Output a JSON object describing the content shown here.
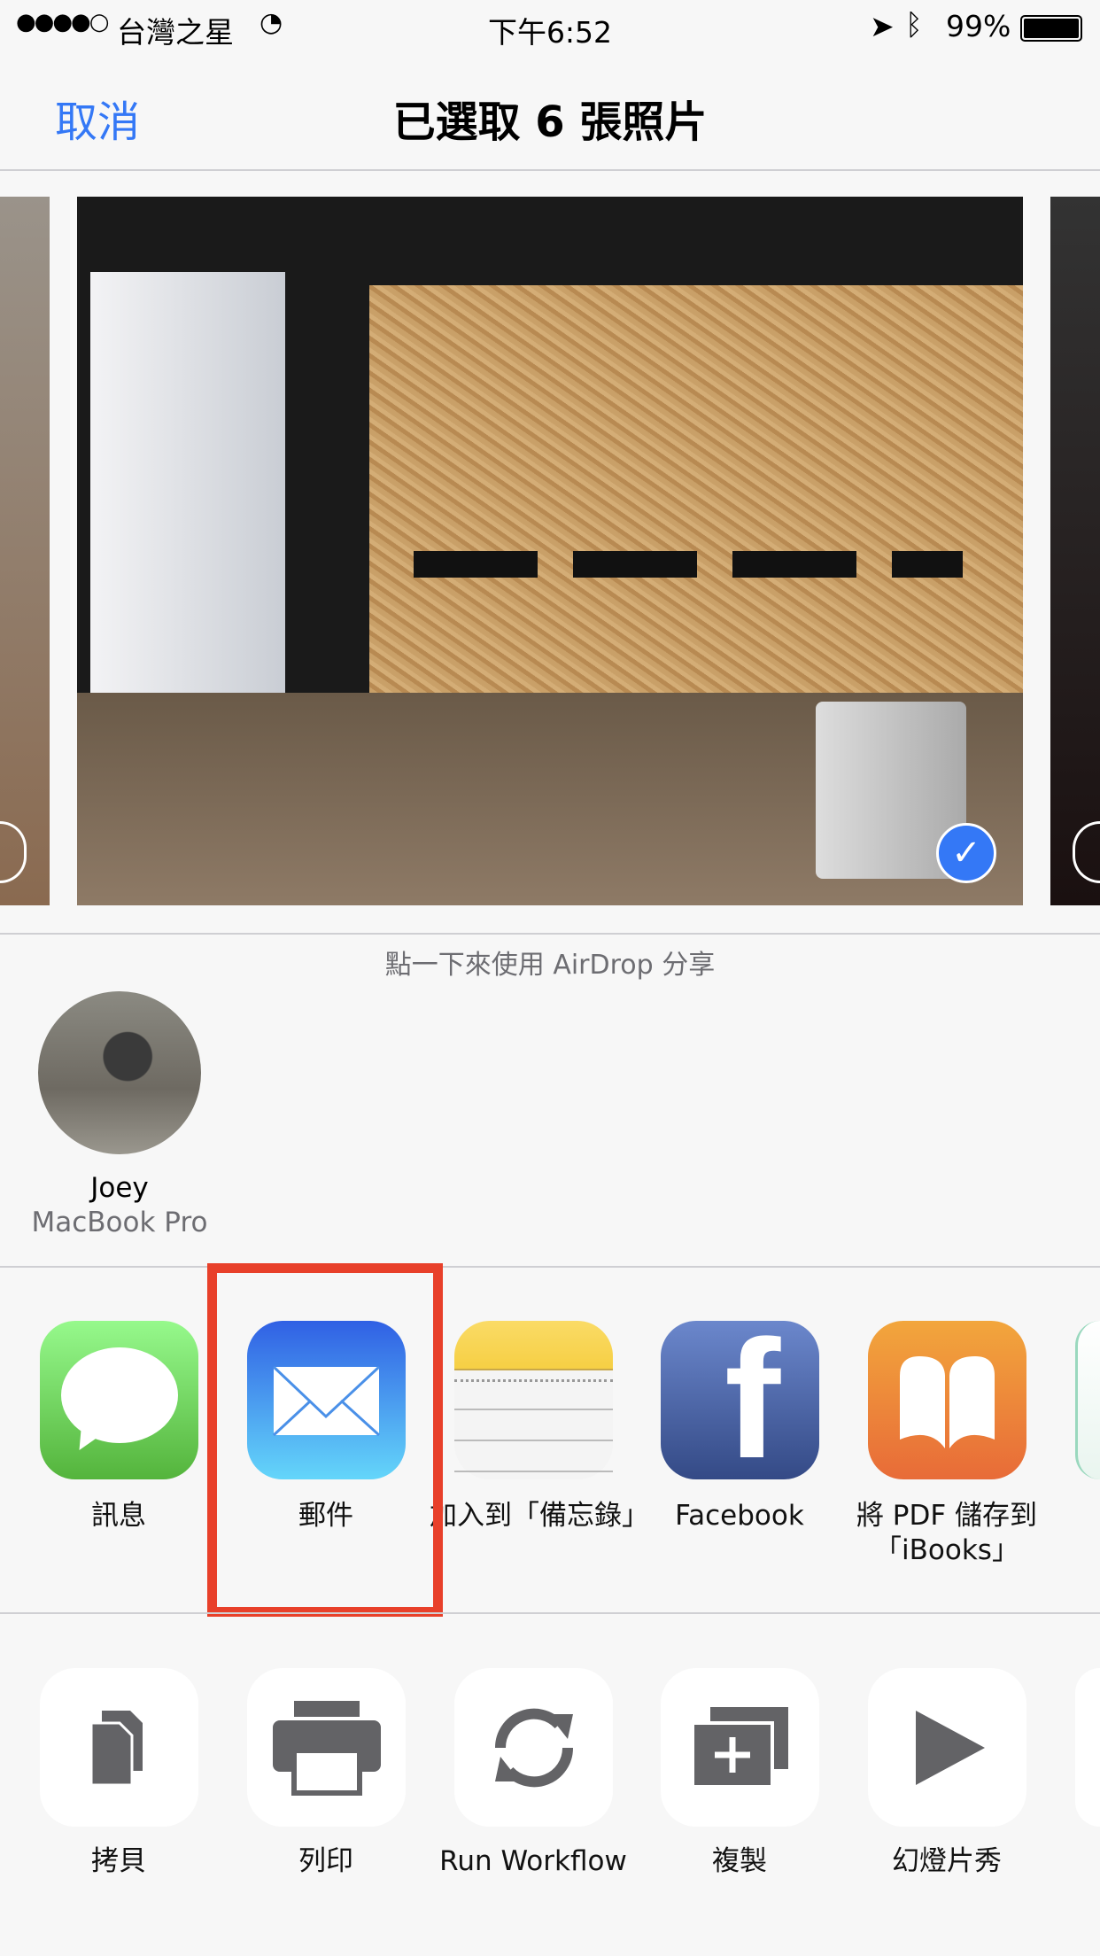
{
  "status_bar": {
    "signal": "●●●●○",
    "carrier": "台灣之星",
    "time": "下午6:52",
    "battery": "99%"
  },
  "nav": {
    "cancel": "取消",
    "title": "已選取 6 張照片"
  },
  "photos": {
    "selected": true
  },
  "airdrop": {
    "hint": "點一下來使用 AirDrop 分享",
    "device": {
      "name": "Joey",
      "type": "MacBook Pro"
    }
  },
  "share_apps": [
    {
      "label": "訊息",
      "icon": "messages-icon"
    },
    {
      "label": "郵件",
      "icon": "mail-icon",
      "highlighted": true
    },
    {
      "label": "加入到「備忘錄」",
      "icon": "notes-icon"
    },
    {
      "label": "Facebook",
      "icon": "facebook-icon"
    },
    {
      "label": "將 PDF 儲存到「iBooks」",
      "icon": "ibooks-icon"
    }
  ],
  "actions": [
    {
      "label": "拷貝",
      "icon": "copy-icon"
    },
    {
      "label": "列印",
      "icon": "print-icon"
    },
    {
      "label": "Run Workflow",
      "icon": "workflow-icon"
    },
    {
      "label": "複製",
      "icon": "duplicate-icon"
    },
    {
      "label": "幻燈片秀",
      "icon": "slideshow-icon"
    }
  ],
  "colors": {
    "accent": "#3478f6",
    "highlight": "#e8402a"
  }
}
